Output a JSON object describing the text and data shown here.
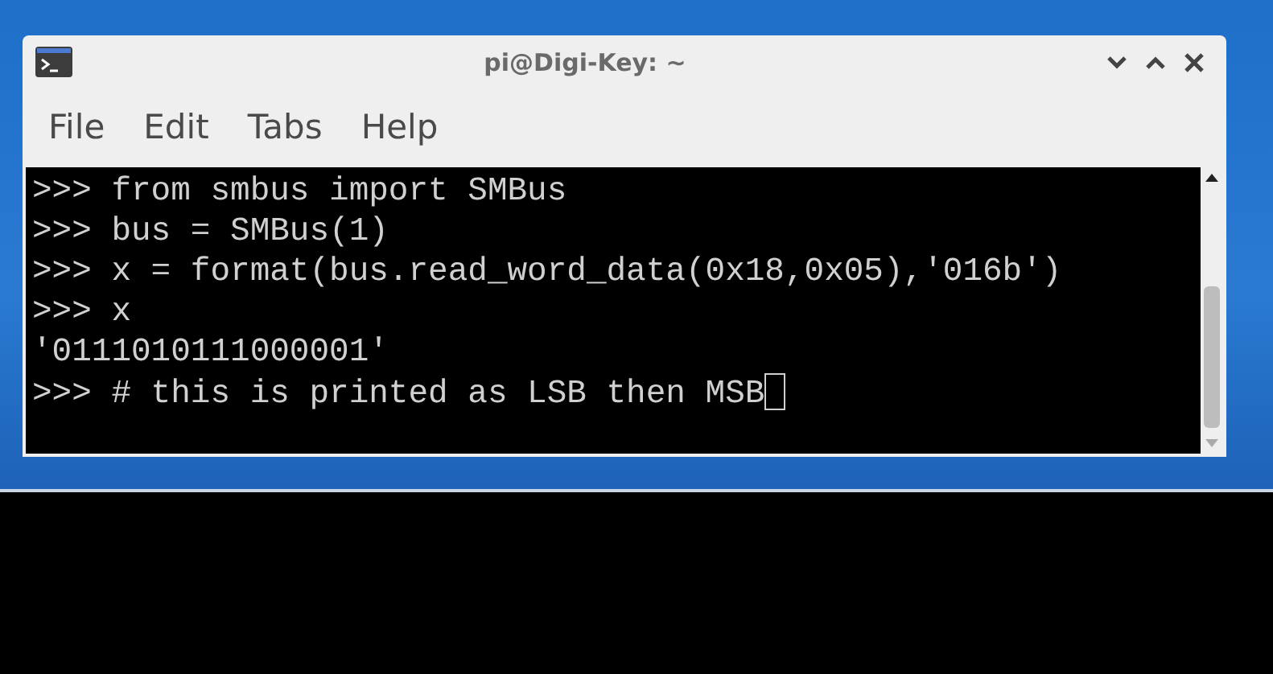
{
  "window": {
    "title": "pi@Digi-Key: ~"
  },
  "menu": [
    "File",
    "Edit",
    "Tabs",
    "Help"
  ],
  "terminal": {
    "lines": [
      {
        "kind": "input",
        "prompt": ">>>",
        "text": "from smbus import SMBus"
      },
      {
        "kind": "input",
        "prompt": ">>>",
        "text": "bus = SMBus(1)"
      },
      {
        "kind": "input",
        "prompt": ">>>",
        "text": "x = format(bus.read_word_data(0x18,0x05),'016b')"
      },
      {
        "kind": "input",
        "prompt": ">>>",
        "text": "x"
      },
      {
        "kind": "output",
        "text": "'0111010111000001'"
      },
      {
        "kind": "input",
        "prompt": ">>>",
        "text": "# this is printed as LSB then MSB",
        "cursor": true
      }
    ]
  }
}
